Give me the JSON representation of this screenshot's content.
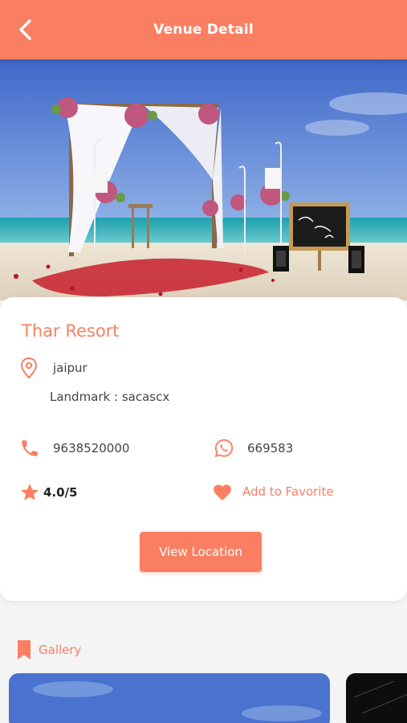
{
  "header": {
    "title": "Venue Detail"
  },
  "venue": {
    "name": "Thar Resort",
    "city": "jaipur",
    "landmark": "Landmark : sacascx",
    "phone": "9638520000",
    "whatsapp": "669583",
    "rating": "4.0/5",
    "favorite_label": "Add to Favorite",
    "view_location_label": "View Location"
  },
  "gallery": {
    "label": "Gallery"
  },
  "colors": {
    "accent": "#fa7f62",
    "card": "#ffffff",
    "background": "#f4f4f4"
  }
}
